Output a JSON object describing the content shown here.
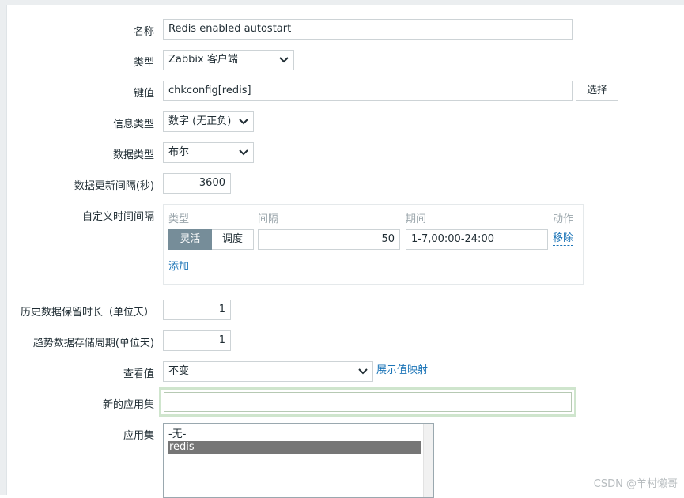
{
  "form": {
    "name": {
      "label": "名称",
      "value": "Redis enabled autostart"
    },
    "type": {
      "label": "类型",
      "value": "Zabbix 客户端"
    },
    "key": {
      "label": "键值",
      "value": "chkconfig[redis]",
      "select_button": "选择"
    },
    "info_type": {
      "label": "信息类型",
      "value": "数字 (无正负)"
    },
    "data_type": {
      "label": "数据类型",
      "value": "布尔"
    },
    "update_interval": {
      "label": "数据更新间隔(秒)",
      "value": "3600"
    },
    "custom_intervals": {
      "label": "自定义时间间隔",
      "headers": {
        "type": "类型",
        "interval": "间隔",
        "period": "期间",
        "action": "动作"
      },
      "row": {
        "mode_active": "灵活",
        "mode_inactive": "调度",
        "interval": "50",
        "period": "1-7,00:00-24:00",
        "remove": "移除"
      },
      "add": "添加"
    },
    "history": {
      "label": "历史数据保留时长（单位天）",
      "value": "1"
    },
    "trends": {
      "label": "趋势数据存储周期(单位天)",
      "value": "1"
    },
    "show_value": {
      "label": "查看值",
      "value": "不变",
      "mapping_link": "展示值映射"
    },
    "new_application": {
      "label": "新的应用集",
      "value": ""
    },
    "applications": {
      "label": "应用集",
      "options": [
        "-无-",
        "redis"
      ],
      "selected": "redis"
    }
  },
  "watermark": "CSDN @羊村懒哥"
}
